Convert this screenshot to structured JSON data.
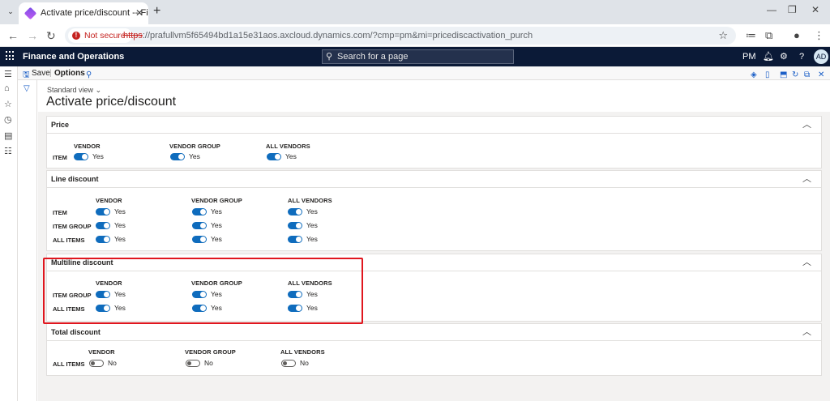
{
  "browser": {
    "tab_title": "Activate price/discount -- Finan",
    "tab_close": "✕",
    "new_tab": "+",
    "not_secure": "Not secure",
    "url_proto": "https",
    "url_rest": "://prafullvm5f65494bd1a15e31aos.axcloud.dynamics.com/?cmp=pm&mi=pricediscactivation_purch"
  },
  "nav": {
    "app_name": "Finance and Operations",
    "search_placeholder": "Search for a page",
    "company": "PM",
    "help": "?",
    "avatar": "AD"
  },
  "actions": {
    "save": "Save",
    "options": "Options"
  },
  "page": {
    "view": "Standard view",
    "title": "Activate price/discount"
  },
  "price": {
    "title": "Price",
    "cols": [
      "VENDOR",
      "VENDOR GROUP",
      "ALL VENDORS"
    ],
    "rows": [
      {
        "label": "ITEM",
        "values": [
          "Yes",
          "Yes",
          "Yes"
        ]
      }
    ]
  },
  "line_discount": {
    "title": "Line discount",
    "cols": [
      "VENDOR",
      "VENDOR GROUP",
      "ALL VENDORS"
    ],
    "rows": [
      {
        "label": "ITEM",
        "values": [
          "Yes",
          "Yes",
          "Yes"
        ]
      },
      {
        "label": "ITEM GROUP",
        "values": [
          "Yes",
          "Yes",
          "Yes"
        ]
      },
      {
        "label": "ALL ITEMS",
        "values": [
          "Yes",
          "Yes",
          "Yes"
        ]
      }
    ]
  },
  "multiline_discount": {
    "title": "Multiline discount",
    "cols": [
      "VENDOR",
      "VENDOR GROUP",
      "ALL VENDORS"
    ],
    "rows": [
      {
        "label": "ITEM GROUP",
        "values": [
          "Yes",
          "Yes",
          "Yes"
        ]
      },
      {
        "label": "ALL ITEMS",
        "values": [
          "Yes",
          "Yes",
          "Yes"
        ]
      }
    ]
  },
  "total_discount": {
    "title": "Total discount",
    "cols": [
      "VENDOR",
      "VENDOR GROUP",
      "ALL VENDORS"
    ],
    "rows": [
      {
        "label": "ALL ITEMS",
        "values": [
          "No",
          "No",
          "No"
        ]
      }
    ]
  },
  "colors": {
    "nav_bg": "#0b1a37",
    "toggle_on": "#0f6cbd",
    "highlight": "#e0161e",
    "not_secure": "#c5221f"
  }
}
